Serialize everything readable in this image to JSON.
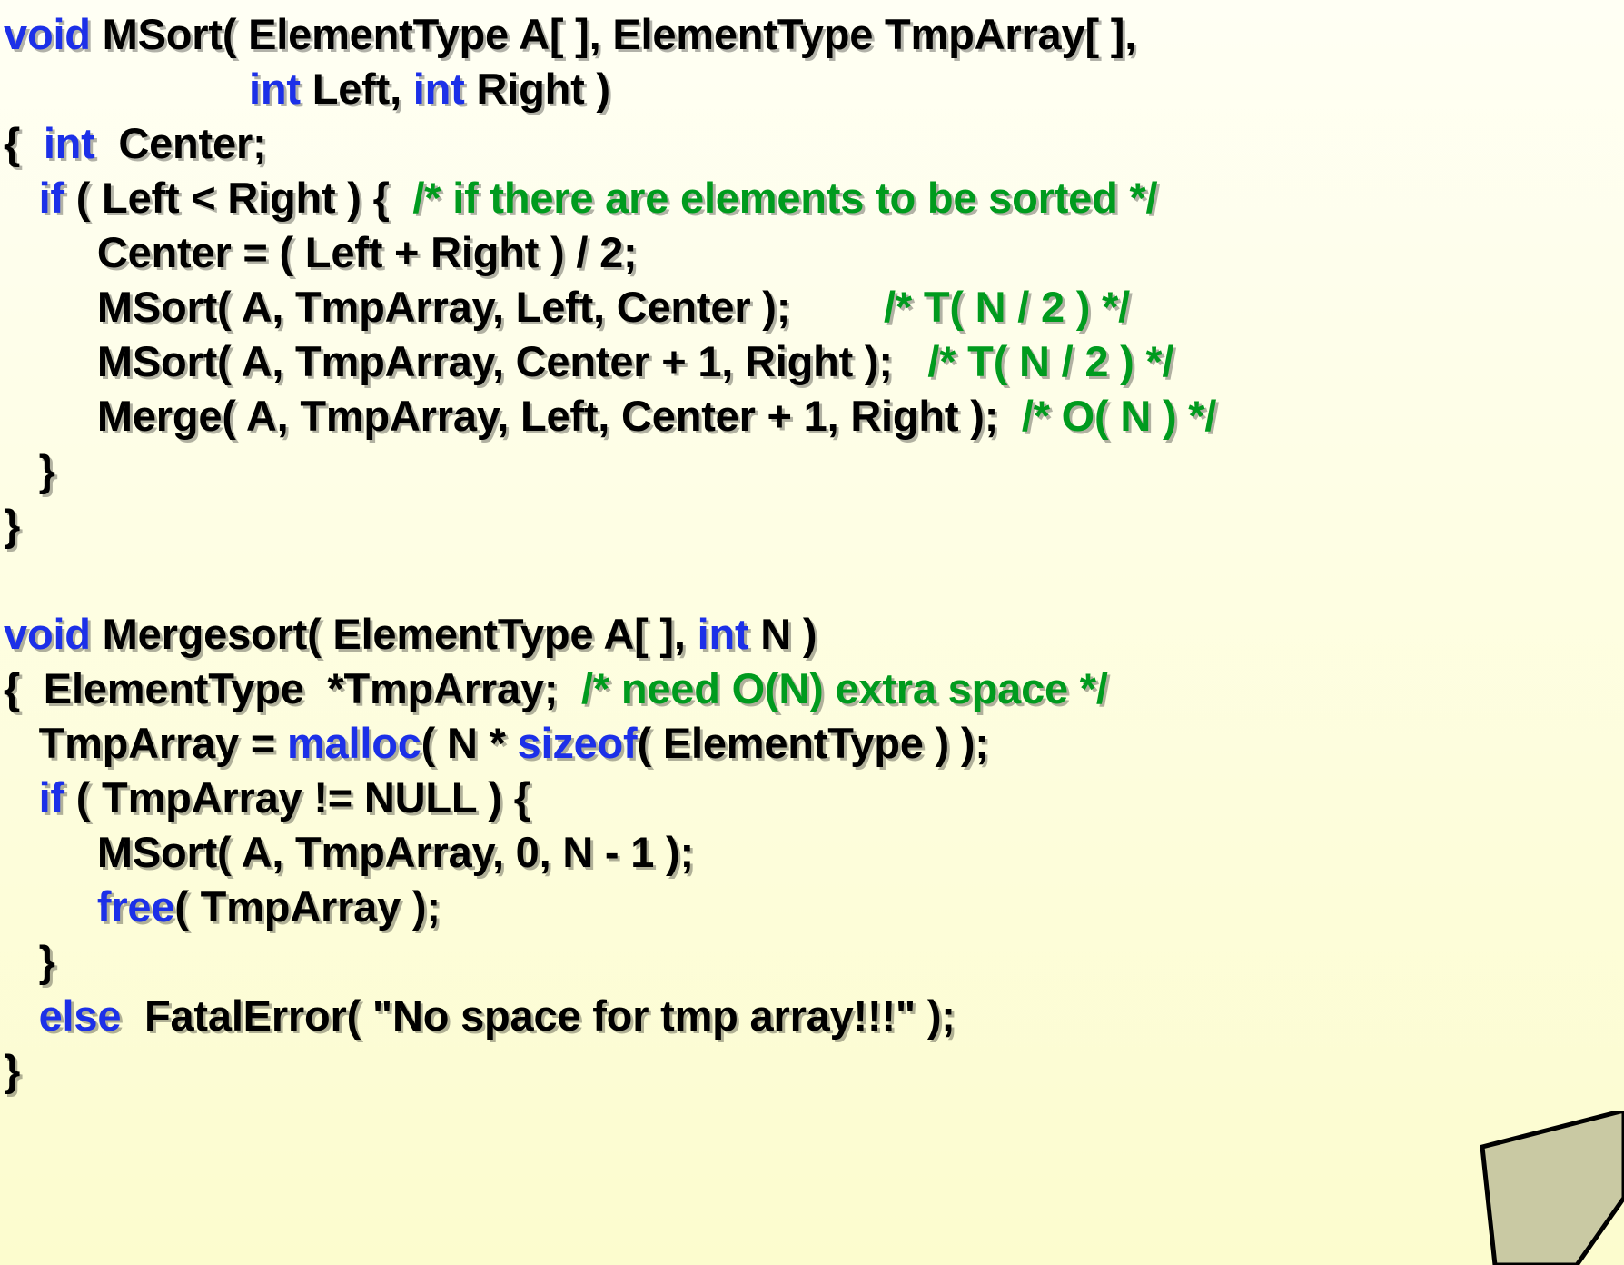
{
  "slide": {
    "title_semantic": "mergesort-c-code-slide",
    "background_top_color": "#FFFFF4",
    "background_bottom_color": "#FCFCCE",
    "keyword_color": "#1C30E8",
    "comment_color": "#009B1E",
    "code_color": "#000000",
    "decoration_fill": "#C9C9A3",
    "decoration_stroke": "#000000"
  },
  "code": {
    "lines": [
      {
        "id": "msort-signature-1",
        "indent": 0,
        "tokens": [
          {
            "type": "kw",
            "text": "void"
          },
          {
            "type": "plain",
            "text": " MSort( ElementType A[ ], ElementType TmpArray[ ],"
          }
        ]
      },
      {
        "id": "msort-signature-2",
        "indent": 0,
        "tokens": [
          {
            "type": "plain",
            "text": "                     "
          },
          {
            "type": "kw",
            "text": "int"
          },
          {
            "type": "plain",
            "text": " Left, "
          },
          {
            "type": "kw",
            "text": "int"
          },
          {
            "type": "plain",
            "text": " Right )"
          }
        ]
      },
      {
        "id": "msort-open-brace-decl",
        "indent": 0,
        "tokens": [
          {
            "type": "plain",
            "text": "{  "
          },
          {
            "type": "kw",
            "text": "int"
          },
          {
            "type": "plain",
            "text": "  Center;"
          }
        ]
      },
      {
        "id": "msort-if-left-lt-right",
        "indent": 0,
        "tokens": [
          {
            "type": "plain",
            "text": "   "
          },
          {
            "type": "kw",
            "text": "if"
          },
          {
            "type": "plain",
            "text": " ( Left < Right ) {  "
          },
          {
            "type": "cmt",
            "text": "/* if there are elements to be sorted */"
          }
        ]
      },
      {
        "id": "msort-center-assign",
        "indent": 0,
        "tokens": [
          {
            "type": "plain",
            "text": "        Center = ( Left + Right ) / 2;"
          }
        ]
      },
      {
        "id": "msort-recurse-left",
        "indent": 0,
        "tokens": [
          {
            "type": "plain",
            "text": "        MSort( A, TmpArray, Left, Center );        "
          },
          {
            "type": "cmt",
            "text": "/* T( N / 2 ) */"
          }
        ]
      },
      {
        "id": "msort-recurse-right",
        "indent": 0,
        "tokens": [
          {
            "type": "plain",
            "text": "        MSort( A, TmpArray, Center + 1, Right );   "
          },
          {
            "type": "cmt",
            "text": "/* T( N / 2 ) */"
          }
        ]
      },
      {
        "id": "msort-merge-call",
        "indent": 0,
        "tokens": [
          {
            "type": "plain",
            "text": "        Merge( A, TmpArray, Left, Center + 1, Right );  "
          },
          {
            "type": "cmt",
            "text": "/* O( N ) */"
          }
        ]
      },
      {
        "id": "msort-close-if",
        "indent": 0,
        "tokens": [
          {
            "type": "plain",
            "text": "   }"
          }
        ]
      },
      {
        "id": "msort-close-brace",
        "indent": 0,
        "tokens": [
          {
            "type": "plain",
            "text": "}"
          }
        ]
      },
      {
        "id": "blank-separator",
        "indent": 0,
        "blank": true,
        "tokens": []
      },
      {
        "id": "mergesort-signature",
        "indent": 0,
        "tokens": [
          {
            "type": "kw",
            "text": "void"
          },
          {
            "type": "plain",
            "text": " Mergesort( ElementType A[ ], "
          },
          {
            "type": "kw",
            "text": "int"
          },
          {
            "type": "plain",
            "text": " N )"
          }
        ]
      },
      {
        "id": "mergesort-open-brace-decl",
        "indent": 0,
        "tokens": [
          {
            "type": "plain",
            "text": "{  ElementType  *TmpArray;  "
          },
          {
            "type": "cmt",
            "text": "/* need O(N) extra space */"
          }
        ]
      },
      {
        "id": "mergesort-malloc",
        "indent": 0,
        "tokens": [
          {
            "type": "plain",
            "text": "   TmpArray = "
          },
          {
            "type": "kw",
            "text": "malloc"
          },
          {
            "type": "plain",
            "text": "( N * "
          },
          {
            "type": "kw",
            "text": "sizeof"
          },
          {
            "type": "plain",
            "text": "( ElementType ) );"
          }
        ]
      },
      {
        "id": "mergesort-if-not-null",
        "indent": 0,
        "tokens": [
          {
            "type": "plain",
            "text": "   "
          },
          {
            "type": "kw",
            "text": "if"
          },
          {
            "type": "plain",
            "text": " ( TmpArray != NULL ) {"
          }
        ]
      },
      {
        "id": "mergesort-msort-call",
        "indent": 0,
        "tokens": [
          {
            "type": "plain",
            "text": "        MSort( A, TmpArray, 0, N - 1 );"
          }
        ]
      },
      {
        "id": "mergesort-free-call",
        "indent": 0,
        "tokens": [
          {
            "type": "plain",
            "text": "        "
          },
          {
            "type": "kw",
            "text": "free"
          },
          {
            "type": "plain",
            "text": "( TmpArray );"
          }
        ]
      },
      {
        "id": "mergesort-close-if",
        "indent": 0,
        "tokens": [
          {
            "type": "plain",
            "text": "   }"
          }
        ]
      },
      {
        "id": "mergesort-else-fatalerror",
        "indent": 0,
        "tokens": [
          {
            "type": "plain",
            "text": "   "
          },
          {
            "type": "kw",
            "text": "else"
          },
          {
            "type": "plain",
            "text": "  FatalError( \"No space for tmp array!!!\" );"
          }
        ]
      },
      {
        "id": "mergesort-close-brace",
        "indent": 0,
        "tokens": [
          {
            "type": "plain",
            "text": "}"
          }
        ]
      }
    ]
  }
}
